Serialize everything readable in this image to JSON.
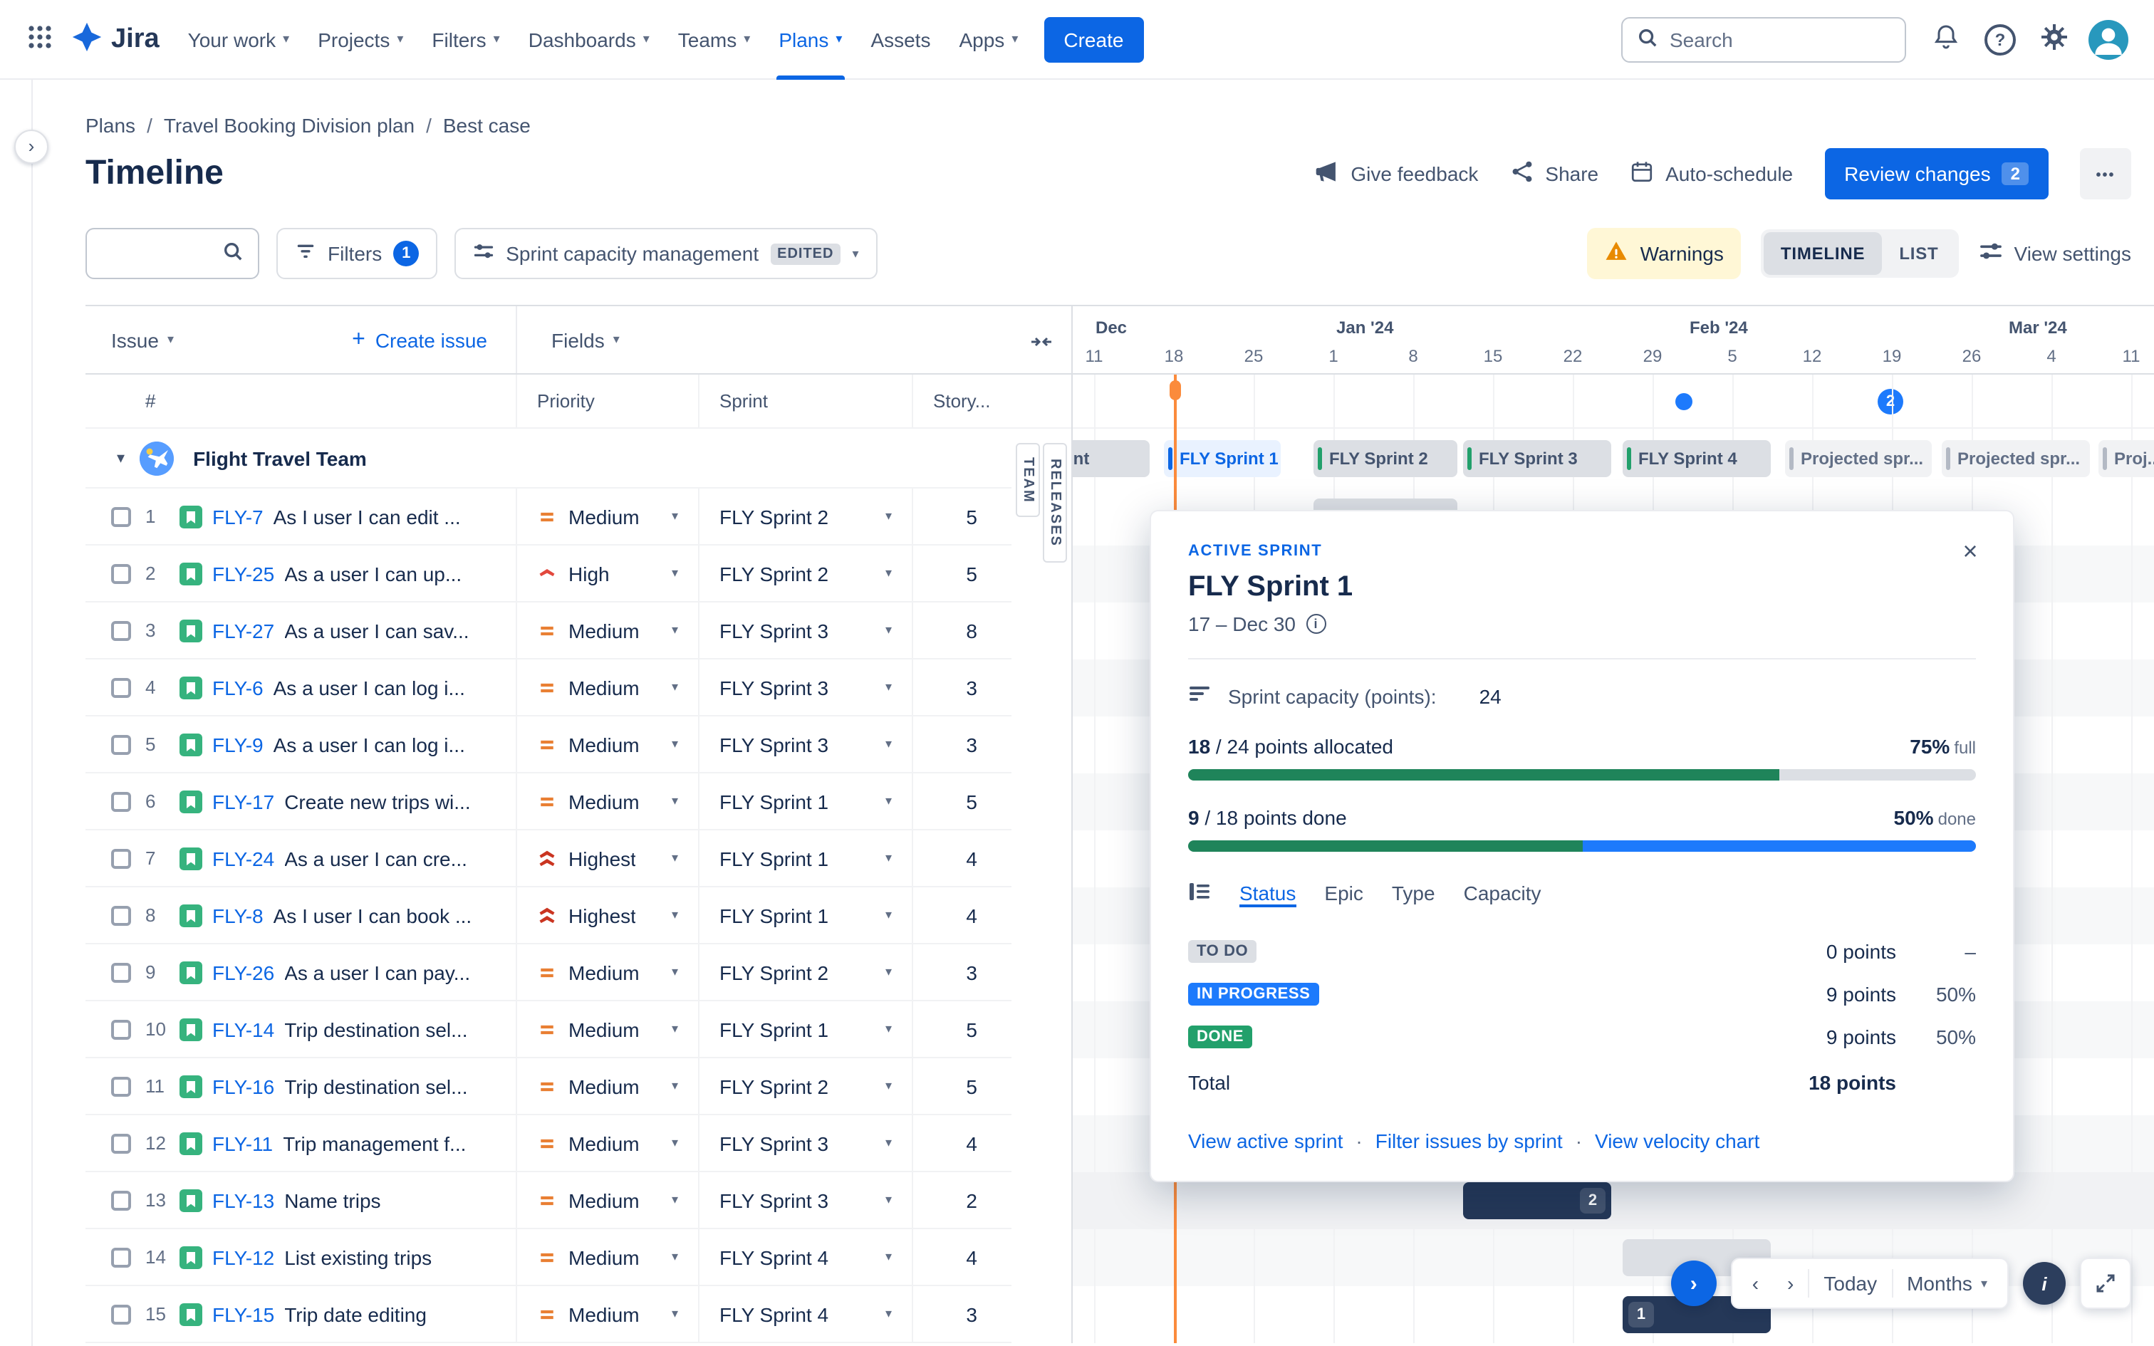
{
  "nav": {
    "logo_text": "Jira",
    "items": [
      {
        "label": "Your work",
        "dropdown": true
      },
      {
        "label": "Projects",
        "dropdown": true
      },
      {
        "label": "Filters",
        "dropdown": true
      },
      {
        "label": "Dashboards",
        "dropdown": true
      },
      {
        "label": "Teams",
        "dropdown": true
      },
      {
        "label": "Plans",
        "dropdown": true,
        "active": true
      },
      {
        "label": "Assets",
        "dropdown": false
      },
      {
        "label": "Apps",
        "dropdown": true
      }
    ],
    "create_label": "Create",
    "search_placeholder": "Search"
  },
  "breadcrumb": [
    "Plans",
    "Travel Booking Division plan",
    "Best case"
  ],
  "page_title": "Timeline",
  "header_actions": {
    "give_feedback": "Give feedback",
    "share": "Share",
    "auto_schedule": "Auto-schedule",
    "review_changes": "Review changes",
    "review_badge": "2"
  },
  "toolbar": {
    "filters_label": "Filters",
    "filters_count": "1",
    "view_name": "Sprint capacity management",
    "edited_badge": "EDITED",
    "warnings_label": "Warnings",
    "timeline_toggle": "TIMELINE",
    "list_toggle": "LIST",
    "view_settings": "View settings"
  },
  "table": {
    "issue_menu": "Issue",
    "create_issue": "Create issue",
    "fields_menu": "Fields",
    "columns": {
      "hash": "#",
      "priority": "Priority",
      "sprint": "Sprint",
      "story_points": "Story..."
    },
    "group": {
      "name": "Flight Travel Team"
    },
    "rows": [
      {
        "num": "1",
        "key": "FLY-7",
        "title": "As I user I can edit ...",
        "priority": "Medium",
        "sprint": "FLY Sprint 2",
        "points": "5"
      },
      {
        "num": "2",
        "key": "FLY-25",
        "title": "As a user I can up...",
        "priority": "High",
        "sprint": "FLY Sprint 2",
        "points": "5"
      },
      {
        "num": "3",
        "key": "FLY-27",
        "title": "As a user I can sav...",
        "priority": "Medium",
        "sprint": "FLY Sprint 3",
        "points": "8"
      },
      {
        "num": "4",
        "key": "FLY-6",
        "title": "As a user I can log i...",
        "priority": "Medium",
        "sprint": "FLY Sprint 3",
        "points": "3"
      },
      {
        "num": "5",
        "key": "FLY-9",
        "title": "As a user I can log i...",
        "priority": "Medium",
        "sprint": "FLY Sprint 3",
        "points": "3"
      },
      {
        "num": "6",
        "key": "FLY-17",
        "title": "Create new trips wi...",
        "priority": "Medium",
        "sprint": "FLY Sprint 1",
        "points": "5"
      },
      {
        "num": "7",
        "key": "FLY-24",
        "title": "As a user I can cre...",
        "priority": "Highest",
        "sprint": "FLY Sprint 1",
        "points": "4"
      },
      {
        "num": "8",
        "key": "FLY-8",
        "title": "As I user I can book ...",
        "priority": "Highest",
        "sprint": "FLY Sprint 1",
        "points": "4"
      },
      {
        "num": "9",
        "key": "FLY-26",
        "title": "As a user I can pay...",
        "priority": "Medium",
        "sprint": "FLY Sprint 2",
        "points": "3"
      },
      {
        "num": "10",
        "key": "FLY-14",
        "title": "Trip destination sel...",
        "priority": "Medium",
        "sprint": "FLY Sprint 1",
        "points": "5"
      },
      {
        "num": "11",
        "key": "FLY-16",
        "title": "Trip destination sel...",
        "priority": "Medium",
        "sprint": "FLY Sprint 2",
        "points": "5"
      },
      {
        "num": "12",
        "key": "FLY-11",
        "title": "Trip management f...",
        "priority": "Medium",
        "sprint": "FLY Sprint 3",
        "points": "4"
      },
      {
        "num": "13",
        "key": "FLY-13",
        "title": "Name trips",
        "priority": "Medium",
        "sprint": "FLY Sprint 3",
        "points": "2"
      },
      {
        "num": "14",
        "key": "FLY-12",
        "title": "List existing trips",
        "priority": "Medium",
        "sprint": "FLY Sprint 4",
        "points": "4"
      },
      {
        "num": "15",
        "key": "FLY-15",
        "title": "Trip date editing",
        "priority": "Medium",
        "sprint": "FLY Sprint 4",
        "points": "3"
      }
    ]
  },
  "timeline": {
    "row_labels": {
      "team": "TEAM",
      "releases": "RELEASES"
    },
    "months": [
      {
        "label": "Dec",
        "ticks": [
          "11",
          "18",
          "25"
        ]
      },
      {
        "label": "Jan '24",
        "ticks": [
          "1",
          "8",
          "15",
          "22",
          "29"
        ]
      },
      {
        "label": "Feb '24",
        "ticks": [
          "5",
          "12",
          "19",
          "26"
        ]
      },
      {
        "label": "Mar '24",
        "ticks": [
          "4",
          "11"
        ]
      }
    ],
    "sprint_chips": [
      {
        "label": "int",
        "style": "gray"
      },
      {
        "label": "FLY Sprint 1",
        "style": "active"
      },
      {
        "label": "FLY Sprint 2",
        "style": "gray"
      },
      {
        "label": "FLY Sprint 3",
        "style": "gray"
      },
      {
        "label": "FLY Sprint 4",
        "style": "gray"
      },
      {
        "label": "Projected spr...",
        "style": "projected"
      },
      {
        "label": "Projected spr...",
        "style": "projected"
      },
      {
        "label": "Proj...",
        "style": "projected"
      }
    ],
    "milestone_count": "2",
    "bars": [
      {
        "sprint": "s2"
      },
      {
        "sprint": "s2"
      },
      {
        "sprint": "s3"
      },
      {
        "sprint": "s3"
      },
      {
        "sprint": "s3"
      },
      {
        "sprint": "s1"
      },
      {
        "sprint": "s1"
      },
      {
        "sprint": "s1"
      },
      {
        "sprint": "s2"
      },
      {
        "sprint": "s1"
      },
      {
        "sprint": "s2"
      },
      {
        "sprint": "s3"
      },
      {
        "sprint": "s3",
        "variant": "navy",
        "badge": "2",
        "badge_side": "right",
        "row_highlight": true
      },
      {
        "sprint": "s4"
      },
      {
        "sprint": "s4",
        "variant": "navy",
        "badge": "1",
        "badge_side": "left"
      }
    ]
  },
  "popup": {
    "badge": "ACTIVE SPRINT",
    "title": "FLY Sprint 1",
    "dates": "17 – Dec 30",
    "capacity_label": "Sprint capacity (points):",
    "capacity_value": "24",
    "allocated_bold": "18",
    "allocated_rest": " / 24 points allocated",
    "allocated_pct": "75%",
    "allocated_pct_suffix": "full",
    "allocated_ratio": 75,
    "done_bold": "9",
    "done_rest": " / 18 points done",
    "done_pct": "50%",
    "done_pct_suffix": "done",
    "done_ratio": 50,
    "tabs": [
      "Status",
      "Epic",
      "Type",
      "Capacity"
    ],
    "active_tab": "Status",
    "status_rows": [
      {
        "label": "TO DO",
        "type": "todo",
        "points": "0 points",
        "pct": "–"
      },
      {
        "label": "IN PROGRESS",
        "type": "inprogress",
        "points": "9 points",
        "pct": "50%"
      },
      {
        "label": "DONE",
        "type": "done",
        "points": "9 points",
        "pct": "50%"
      }
    ],
    "total_label": "Total",
    "total_value": "18 points",
    "links": [
      "View active sprint",
      "Filter issues by sprint",
      "View velocity chart"
    ]
  },
  "bottom": {
    "today_label": "Today",
    "zoom_label": "Months"
  },
  "colors": {
    "accent": "#0C66E4",
    "sprint_green": "#22A06B",
    "progress_green": "#1F845A",
    "progress_blue": "#1D7AFC",
    "today_orange": "#FB8B3C",
    "warning_orange": "#E88A00",
    "navy_bar": "#253858"
  }
}
